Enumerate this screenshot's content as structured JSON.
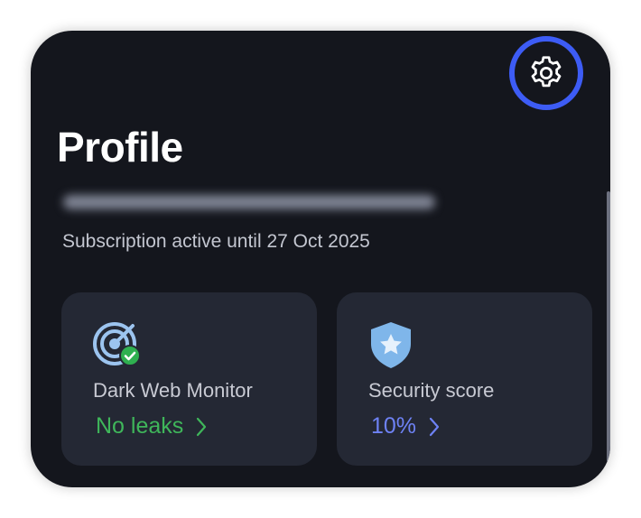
{
  "header": {
    "title": "Profile",
    "settings_icon": "gear-icon"
  },
  "account": {
    "email_redacted": "blurred email address",
    "subscription": "Subscription active until 27 Oct 2025"
  },
  "cards": [
    {
      "icon": "radar-check-icon",
      "label": "Dark Web Monitor",
      "value": "No leaks",
      "value_color": "#3fb65a"
    },
    {
      "icon": "shield-star-icon",
      "label": "Security score",
      "value": "10%",
      "value_color": "#6e82f5"
    }
  ],
  "colors": {
    "background": "#14161d",
    "card": "#242834",
    "accent": "#3d5cf5"
  }
}
